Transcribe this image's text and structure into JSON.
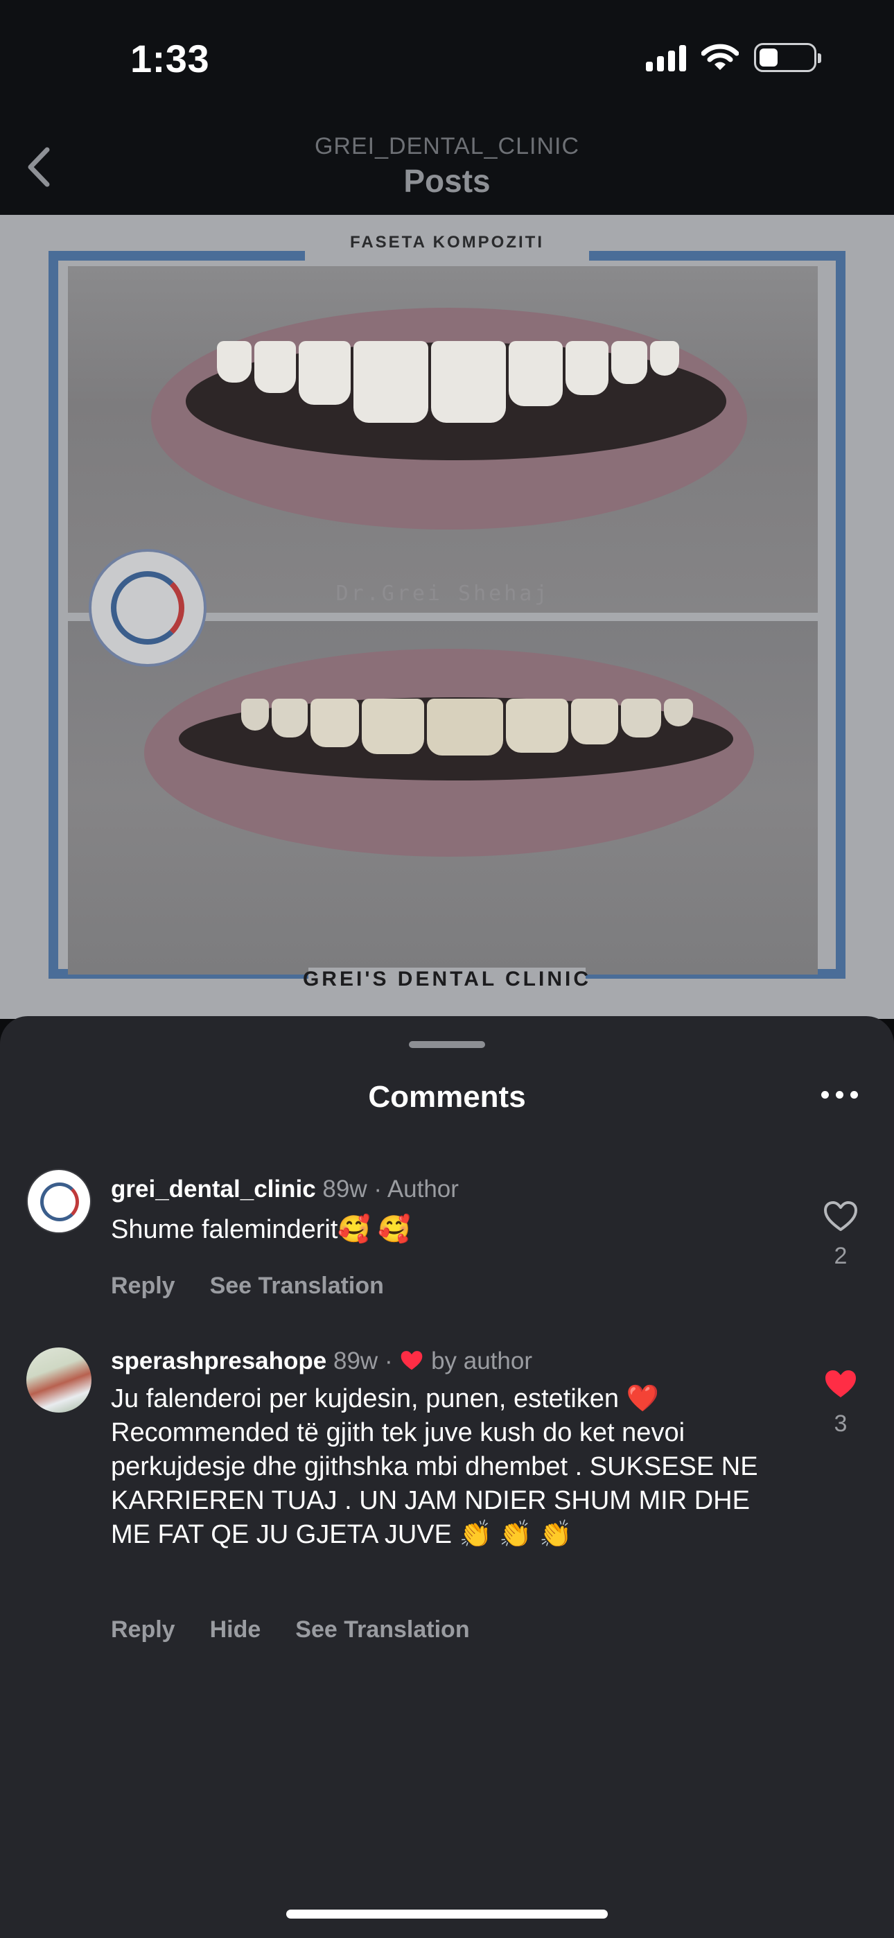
{
  "status": {
    "time": "1:33"
  },
  "header": {
    "account": "GREI_DENTAL_CLINIC",
    "title": "Posts"
  },
  "post": {
    "caption_top": "FASETA KOMPOZITI",
    "watermark": "Dr.Grei Shehaj",
    "caption_bottom": "GREI'S DENTAL CLINIC",
    "logo_text": "GREI'S DENTAL CLINIC"
  },
  "sheet": {
    "title": "Comments"
  },
  "comments": [
    {
      "username": "grei_dental_clinic",
      "time": "89w",
      "separator": "·",
      "tag": "Author",
      "text": "Shume faleminderit🥰 🥰",
      "actions": [
        "Reply",
        "See Translation"
      ],
      "likes": "2",
      "liked": false
    },
    {
      "username": "sperashpresahope",
      "time": "89w",
      "separator": "·",
      "tag": "by author",
      "text": "Ju falenderoi per kujdesin, punen, estetiken ❤️ Recommended të gjith tek juve kush do ket nevoi perkujdesje dhe gjithshka mbi dhembet . SUKSESE NE KARRIEREN TUAJ . UN JAM NDIER SHUM MIR DHE ME FAT QE JU GJETA JUVE 👏 👏 👏",
      "actions": [
        "Reply",
        "Hide",
        "See Translation"
      ],
      "likes": "3",
      "liked": true
    }
  ],
  "colors": {
    "sheet_bg": "#25262b",
    "like_red": "#ff2d45",
    "muted": "#9a9ca1",
    "frame_blue": "#4a6d98"
  },
  "icons": [
    "back-chevron-icon",
    "signal-icon",
    "wifi-icon",
    "battery-icon",
    "more-icon",
    "heart-outline-icon",
    "heart-filled-icon"
  ]
}
